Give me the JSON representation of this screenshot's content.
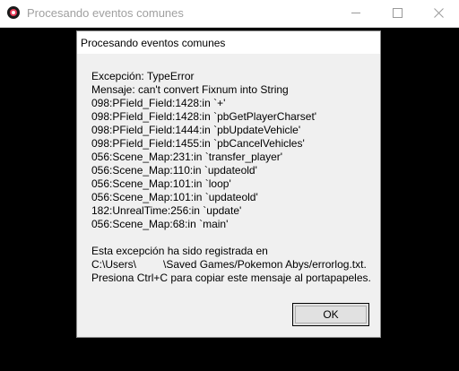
{
  "window": {
    "title": "Procesando eventos comunes",
    "icon": "pokeball-icon",
    "controls": {
      "minimize": "minimize-icon",
      "maximize": "maximize-icon",
      "close": "close-icon"
    }
  },
  "dialog": {
    "title": "Procesando eventos comunes",
    "error_lines": [
      "Excepción: TypeError",
      "Mensaje: can't convert Fixnum into String",
      "098:PField_Field:1428:in `+'",
      "098:PField_Field:1428:in `pbGetPlayerCharset'",
      "098:PField_Field:1444:in `pbUpdateVehicle'",
      "098:PField_Field:1455:in `pbCancelVehicles'",
      "056:Scene_Map:231:in `transfer_player'",
      "056:Scene_Map:110:in `updateold'",
      "056:Scene_Map:101:in `loop'",
      "056:Scene_Map:101:in `updateold'",
      "182:UnrealTime:256:in `update'",
      "056:Scene_Map:68:in `main'"
    ],
    "footer_lines": [
      "Esta excepción ha sido registrada en",
      "C:\\Users\\         \\Saved Games/Pokemon Abys/errorlog.txt.",
      "Presiona Ctrl+C para copiar este mensaje al portapapeles."
    ],
    "ok_label": "OK"
  },
  "colors": {
    "background": "#000000",
    "dialog_bg": "#f0f0f0",
    "titlebar_bg": "#ffffff",
    "icon_accent": "#e83a57"
  }
}
